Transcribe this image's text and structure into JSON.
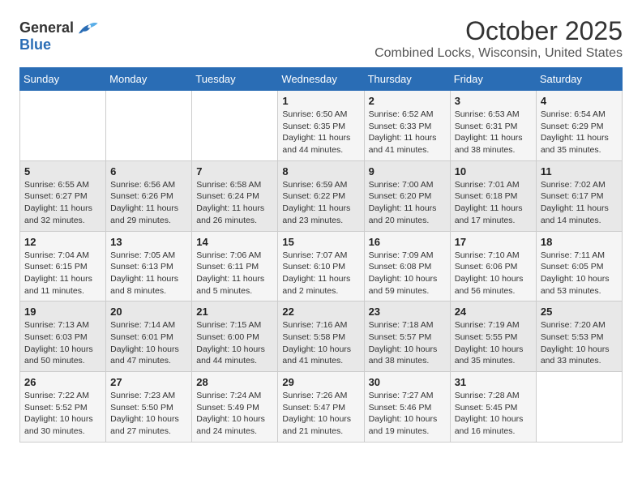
{
  "logo": {
    "general": "General",
    "blue": "Blue"
  },
  "title": "October 2025",
  "subtitle": "Combined Locks, Wisconsin, United States",
  "days_of_week": [
    "Sunday",
    "Monday",
    "Tuesday",
    "Wednesday",
    "Thursday",
    "Friday",
    "Saturday"
  ],
  "weeks": [
    [
      {
        "num": "",
        "sunrise": "",
        "sunset": "",
        "daylight": ""
      },
      {
        "num": "",
        "sunrise": "",
        "sunset": "",
        "daylight": ""
      },
      {
        "num": "",
        "sunrise": "",
        "sunset": "",
        "daylight": ""
      },
      {
        "num": "1",
        "sunrise": "Sunrise: 6:50 AM",
        "sunset": "Sunset: 6:35 PM",
        "daylight": "Daylight: 11 hours and 44 minutes."
      },
      {
        "num": "2",
        "sunrise": "Sunrise: 6:52 AM",
        "sunset": "Sunset: 6:33 PM",
        "daylight": "Daylight: 11 hours and 41 minutes."
      },
      {
        "num": "3",
        "sunrise": "Sunrise: 6:53 AM",
        "sunset": "Sunset: 6:31 PM",
        "daylight": "Daylight: 11 hours and 38 minutes."
      },
      {
        "num": "4",
        "sunrise": "Sunrise: 6:54 AM",
        "sunset": "Sunset: 6:29 PM",
        "daylight": "Daylight: 11 hours and 35 minutes."
      }
    ],
    [
      {
        "num": "5",
        "sunrise": "Sunrise: 6:55 AM",
        "sunset": "Sunset: 6:27 PM",
        "daylight": "Daylight: 11 hours and 32 minutes."
      },
      {
        "num": "6",
        "sunrise": "Sunrise: 6:56 AM",
        "sunset": "Sunset: 6:26 PM",
        "daylight": "Daylight: 11 hours and 29 minutes."
      },
      {
        "num": "7",
        "sunrise": "Sunrise: 6:58 AM",
        "sunset": "Sunset: 6:24 PM",
        "daylight": "Daylight: 11 hours and 26 minutes."
      },
      {
        "num": "8",
        "sunrise": "Sunrise: 6:59 AM",
        "sunset": "Sunset: 6:22 PM",
        "daylight": "Daylight: 11 hours and 23 minutes."
      },
      {
        "num": "9",
        "sunrise": "Sunrise: 7:00 AM",
        "sunset": "Sunset: 6:20 PM",
        "daylight": "Daylight: 11 hours and 20 minutes."
      },
      {
        "num": "10",
        "sunrise": "Sunrise: 7:01 AM",
        "sunset": "Sunset: 6:18 PM",
        "daylight": "Daylight: 11 hours and 17 minutes."
      },
      {
        "num": "11",
        "sunrise": "Sunrise: 7:02 AM",
        "sunset": "Sunset: 6:17 PM",
        "daylight": "Daylight: 11 hours and 14 minutes."
      }
    ],
    [
      {
        "num": "12",
        "sunrise": "Sunrise: 7:04 AM",
        "sunset": "Sunset: 6:15 PM",
        "daylight": "Daylight: 11 hours and 11 minutes."
      },
      {
        "num": "13",
        "sunrise": "Sunrise: 7:05 AM",
        "sunset": "Sunset: 6:13 PM",
        "daylight": "Daylight: 11 hours and 8 minutes."
      },
      {
        "num": "14",
        "sunrise": "Sunrise: 7:06 AM",
        "sunset": "Sunset: 6:11 PM",
        "daylight": "Daylight: 11 hours and 5 minutes."
      },
      {
        "num": "15",
        "sunrise": "Sunrise: 7:07 AM",
        "sunset": "Sunset: 6:10 PM",
        "daylight": "Daylight: 11 hours and 2 minutes."
      },
      {
        "num": "16",
        "sunrise": "Sunrise: 7:09 AM",
        "sunset": "Sunset: 6:08 PM",
        "daylight": "Daylight: 10 hours and 59 minutes."
      },
      {
        "num": "17",
        "sunrise": "Sunrise: 7:10 AM",
        "sunset": "Sunset: 6:06 PM",
        "daylight": "Daylight: 10 hours and 56 minutes."
      },
      {
        "num": "18",
        "sunrise": "Sunrise: 7:11 AM",
        "sunset": "Sunset: 6:05 PM",
        "daylight": "Daylight: 10 hours and 53 minutes."
      }
    ],
    [
      {
        "num": "19",
        "sunrise": "Sunrise: 7:13 AM",
        "sunset": "Sunset: 6:03 PM",
        "daylight": "Daylight: 10 hours and 50 minutes."
      },
      {
        "num": "20",
        "sunrise": "Sunrise: 7:14 AM",
        "sunset": "Sunset: 6:01 PM",
        "daylight": "Daylight: 10 hours and 47 minutes."
      },
      {
        "num": "21",
        "sunrise": "Sunrise: 7:15 AM",
        "sunset": "Sunset: 6:00 PM",
        "daylight": "Daylight: 10 hours and 44 minutes."
      },
      {
        "num": "22",
        "sunrise": "Sunrise: 7:16 AM",
        "sunset": "Sunset: 5:58 PM",
        "daylight": "Daylight: 10 hours and 41 minutes."
      },
      {
        "num": "23",
        "sunrise": "Sunrise: 7:18 AM",
        "sunset": "Sunset: 5:57 PM",
        "daylight": "Daylight: 10 hours and 38 minutes."
      },
      {
        "num": "24",
        "sunrise": "Sunrise: 7:19 AM",
        "sunset": "Sunset: 5:55 PM",
        "daylight": "Daylight: 10 hours and 35 minutes."
      },
      {
        "num": "25",
        "sunrise": "Sunrise: 7:20 AM",
        "sunset": "Sunset: 5:53 PM",
        "daylight": "Daylight: 10 hours and 33 minutes."
      }
    ],
    [
      {
        "num": "26",
        "sunrise": "Sunrise: 7:22 AM",
        "sunset": "Sunset: 5:52 PM",
        "daylight": "Daylight: 10 hours and 30 minutes."
      },
      {
        "num": "27",
        "sunrise": "Sunrise: 7:23 AM",
        "sunset": "Sunset: 5:50 PM",
        "daylight": "Daylight: 10 hours and 27 minutes."
      },
      {
        "num": "28",
        "sunrise": "Sunrise: 7:24 AM",
        "sunset": "Sunset: 5:49 PM",
        "daylight": "Daylight: 10 hours and 24 minutes."
      },
      {
        "num": "29",
        "sunrise": "Sunrise: 7:26 AM",
        "sunset": "Sunset: 5:47 PM",
        "daylight": "Daylight: 10 hours and 21 minutes."
      },
      {
        "num": "30",
        "sunrise": "Sunrise: 7:27 AM",
        "sunset": "Sunset: 5:46 PM",
        "daylight": "Daylight: 10 hours and 19 minutes."
      },
      {
        "num": "31",
        "sunrise": "Sunrise: 7:28 AM",
        "sunset": "Sunset: 5:45 PM",
        "daylight": "Daylight: 10 hours and 16 minutes."
      },
      {
        "num": "",
        "sunrise": "",
        "sunset": "",
        "daylight": ""
      }
    ]
  ]
}
